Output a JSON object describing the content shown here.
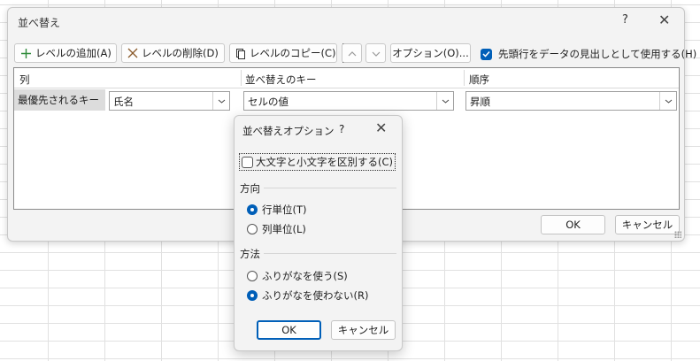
{
  "dialog": {
    "title": "並べ替え",
    "help": "?",
    "close": "✕"
  },
  "toolbar": {
    "add_level": "レベルの追加(A)",
    "delete_level": "レベルの削除(D)",
    "copy_level": "レベルのコピー(C)",
    "options": "オプション(O)...",
    "header_checkbox_label": "先頭行をデータの見出しとして使用する(H)",
    "header_checkbox_checked": true
  },
  "grid": {
    "headers": {
      "column": "列",
      "sort_on": "並べ替えのキー",
      "order": "順序"
    },
    "rows": [
      {
        "label": "最優先されるキー",
        "column": "氏名",
        "sort_on": "セルの値",
        "order": "昇順"
      }
    ]
  },
  "buttons": {
    "ok": "OK",
    "cancel": "キャンセル"
  },
  "options_dialog": {
    "title": "並べ替えオプション",
    "help": "?",
    "close": "✕",
    "case_sensitive_label": "大文字と小文字を区別する(C)",
    "case_sensitive_checked": false,
    "direction_heading": "方向",
    "direction_options": [
      "行単位(T)",
      "列単位(L)"
    ],
    "direction_selected": 0,
    "method_heading": "方法",
    "method_options": [
      "ふりがなを使う(S)",
      "ふりがなを使わない(R)"
    ],
    "method_selected": 1,
    "ok": "OK",
    "cancel": "キャンセル"
  },
  "colors": {
    "accent": "#005fb8",
    "add_icon": "#2e8b3a",
    "delete_icon": "#8a5a2b"
  }
}
